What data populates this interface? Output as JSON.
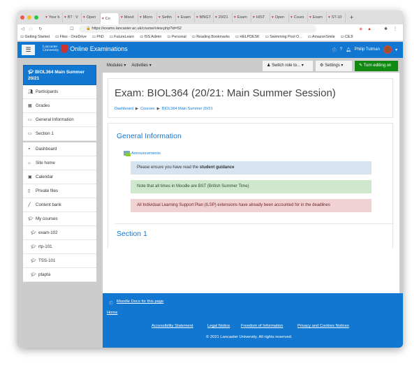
{
  "browser": {
    "tabs": [
      "Your b",
      "BT : V",
      "Open",
      "Co",
      "Mood",
      "Micro",
      "Settin",
      "Exam",
      "MNGT",
      "20/21",
      "Exam",
      "HIST",
      "Open",
      "Cours",
      "Exam",
      "ST-10"
    ],
    "active_tab": 3,
    "url": "https://exams.lancaster.ac.uk/course/view.php?id=52",
    "bookmarks": [
      "Getting Started",
      "Files - OneDrive",
      "PhD",
      "FutureLearn",
      "ISS Admin",
      "Personal",
      "Reading Bookmarks",
      "HELPDESK",
      "Swimming Pool O...",
      "AmazonSmile",
      "CEJI"
    ]
  },
  "header": {
    "logo_text": "Lancaster University",
    "site_name": "Online Examinations",
    "user": "Philip Tutman"
  },
  "sidebar": {
    "course": "BIOL364 Main Summer 20/21",
    "group1": [
      {
        "label": "Participants",
        "icon": "users-icon"
      },
      {
        "label": "Grades",
        "icon": "table-icon"
      },
      {
        "label": "General Information",
        "icon": "folder-icon"
      },
      {
        "label": "Section 1",
        "icon": "folder-icon"
      }
    ],
    "group2": [
      {
        "label": "Dashboard",
        "icon": "dashboard-icon"
      },
      {
        "label": "Site home",
        "icon": "home-icon"
      },
      {
        "label": "Calendar",
        "icon": "calendar-icon"
      },
      {
        "label": "Private files",
        "icon": "file-icon"
      },
      {
        "label": "Content bank",
        "icon": "brush-icon"
      },
      {
        "label": "My courses",
        "icon": "graduation-cap-icon"
      },
      {
        "label": "exam-102",
        "icon": "graduation-cap-icon"
      },
      {
        "label": "rtp-101",
        "icon": "graduation-cap-icon"
      },
      {
        "label": "TSS-101",
        "icon": "graduation-cap-icon"
      },
      {
        "label": "ptapta",
        "icon": "graduation-cap-icon"
      }
    ]
  },
  "navbar": {
    "modules": "Modules",
    "activities": "Activities",
    "switch_role": "Switch role to...",
    "settings": "Settings",
    "edit": "Turn editing on"
  },
  "page": {
    "title": "Exam: BIOL364 (20/21: Main Summer Session)",
    "breadcrumb": [
      "Dashboard",
      "Courses",
      "BIOL364 Main Summer 20/21"
    ],
    "section_general": "General Information",
    "announcements": "Announcements",
    "notice1_prefix": "Please ensure you have read the ",
    "notice1_bold": "student guidance",
    "notice2": "Note that all times in Moodle are BST (British Summer Time)",
    "notice3": "All Individual Learning Support Plan (ILSP) extensions have already been accounted for in the deadlines",
    "section1": "Section 1"
  },
  "footer": {
    "docs": "Moodle Docs for this page",
    "home": "Home",
    "links": [
      "Accessibility Statement",
      "Legal Notice",
      "Freedom of Information",
      "Privacy and Cookies Notices"
    ],
    "copyright": "© 2021 Lancaster University. All rights reserved."
  },
  "colors": {
    "brand": "#1177d1",
    "edit_button": "#118a11",
    "info": "#d6e3f0",
    "success": "#cfe7cd",
    "danger": "#f1d2d4"
  }
}
